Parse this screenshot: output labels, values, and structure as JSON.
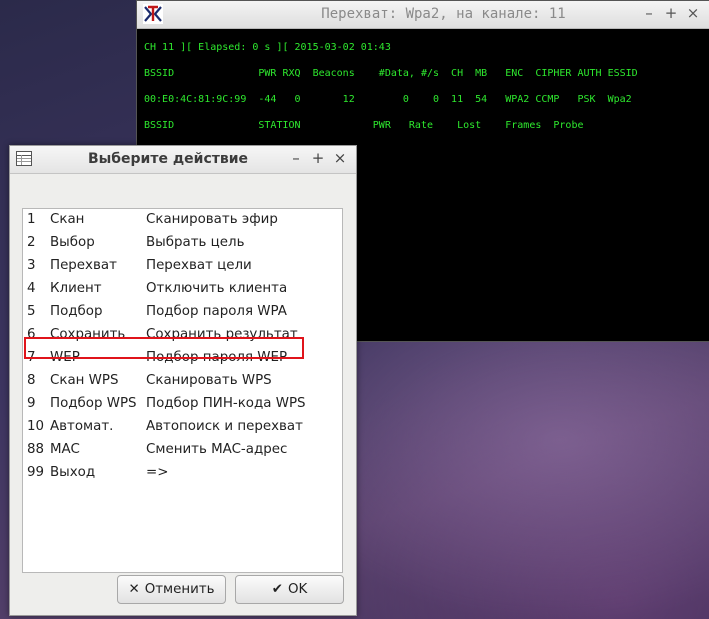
{
  "terminal": {
    "title": "Перехват: Wpa2, на канале:  11",
    "logo_icon": "xterm-logo-icon",
    "controls": [
      "–",
      "+",
      "×"
    ],
    "lines": [
      "CH 11 ][ Elapsed: 0 s ][ 2015-03-02 01:43",
      "BSSID              PWR RXQ  Beacons    #Data, #/s  CH  MB   ENC  CIPHER AUTH ESSID",
      "00:E0:4C:81:9C:99  -44   0       12        0    0  11  54   WPA2 CCMP   PSK  Wpa2",
      "BSSID              STATION            PWR   Rate    Lost    Frames  Probe"
    ],
    "text_color": "#2ee82e"
  },
  "dialog": {
    "title": "Выберите действие",
    "controls": [
      "–",
      "+",
      "×"
    ],
    "items": [
      {
        "num": "1",
        "name": "Скан",
        "desc": "Сканировать эфир"
      },
      {
        "num": "2",
        "name": "Выбор",
        "desc": "Выбрать цель"
      },
      {
        "num": "3",
        "name": "Перехват",
        "desc": "Перехват цели"
      },
      {
        "num": "4",
        "name": "Клиент",
        "desc": "Отключить клиента"
      },
      {
        "num": "5",
        "name": "Подбор",
        "desc": "Подбор пароля WPA"
      },
      {
        "num": "6",
        "name": "Сохранить",
        "desc": "Сохранить результат"
      },
      {
        "num": "7",
        "name": "WEP",
        "desc": "Подбор пароля WEP"
      },
      {
        "num": "8",
        "name": "Скан WPS",
        "desc": "Сканировать WPS"
      },
      {
        "num": "9",
        "name": "Подбор WPS",
        "desc": "Подбор ПИН-кода WPS"
      },
      {
        "num": "10",
        "name": "Автомат.",
        "desc": "Автопоиск и перехват"
      },
      {
        "num": "88",
        "name": "MAC",
        "desc": "Сменить MAC-адрес"
      },
      {
        "num": "99",
        "name": "Выход",
        "desc": "=>"
      }
    ],
    "highlight_color": "#e0141b",
    "cancel_label": "Отменить",
    "cancel_icon": "✕",
    "ok_label": "OK",
    "ok_icon": "✔"
  }
}
